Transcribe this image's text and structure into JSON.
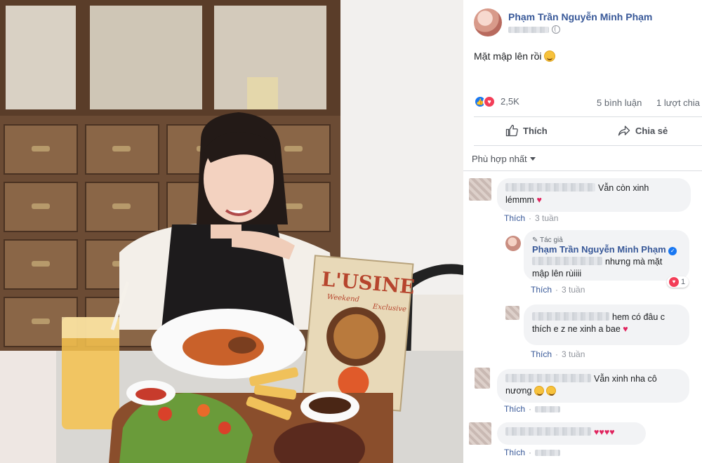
{
  "post": {
    "author": "Phạm Trần Nguyễn Minh Phạm",
    "text": "Mặt mập lên rồi",
    "reaction_count": "2,5K",
    "comment_count": "5 bình luận",
    "share_count": "1 lượt chia sẻ",
    "like_label": "Thích",
    "share_label": "Chia sẻ",
    "sort_label": "Phù hợp nhất"
  },
  "photo": {
    "menu_title": "L'USINE",
    "menu_subtitle_1": "Weekend",
    "menu_subtitle_2": "Exclusive"
  },
  "comments": [
    {
      "text": "Vẫn còn xinh",
      "text2": "lémmm",
      "reply": "Thích",
      "time": "3 tuần"
    },
    {
      "tag": "Tác giả",
      "author": "Phạm Trần Nguyễn Minh Phạm",
      "text": "nhưng mà mặt",
      "text2": "mập lên rùiiii",
      "reply": "Thích",
      "time": "3 tuần",
      "reaction_count": "1"
    },
    {
      "text": "hem có đâu c",
      "text2": "thích e z ne xinh a bae",
      "reply": "Thích",
      "time": "3 tuần"
    },
    {
      "text": "Vẫn xinh nha cô",
      "text2": "nương",
      "reply": "Thích"
    },
    {
      "text": "",
      "reply": "Thích"
    }
  ],
  "colors": {
    "link": "#385898",
    "like_blue": "#1877f2",
    "love_red": "#f33e58",
    "bubble": "#f2f3f5"
  },
  "icons": [
    "like-reaction-icon",
    "love-reaction-icon",
    "thumbs-up-icon",
    "share-arrow-icon",
    "globe-icon",
    "verified-icon",
    "pencil-icon",
    "caret-down-icon",
    "heart-emoji",
    "smile-emoji"
  ]
}
